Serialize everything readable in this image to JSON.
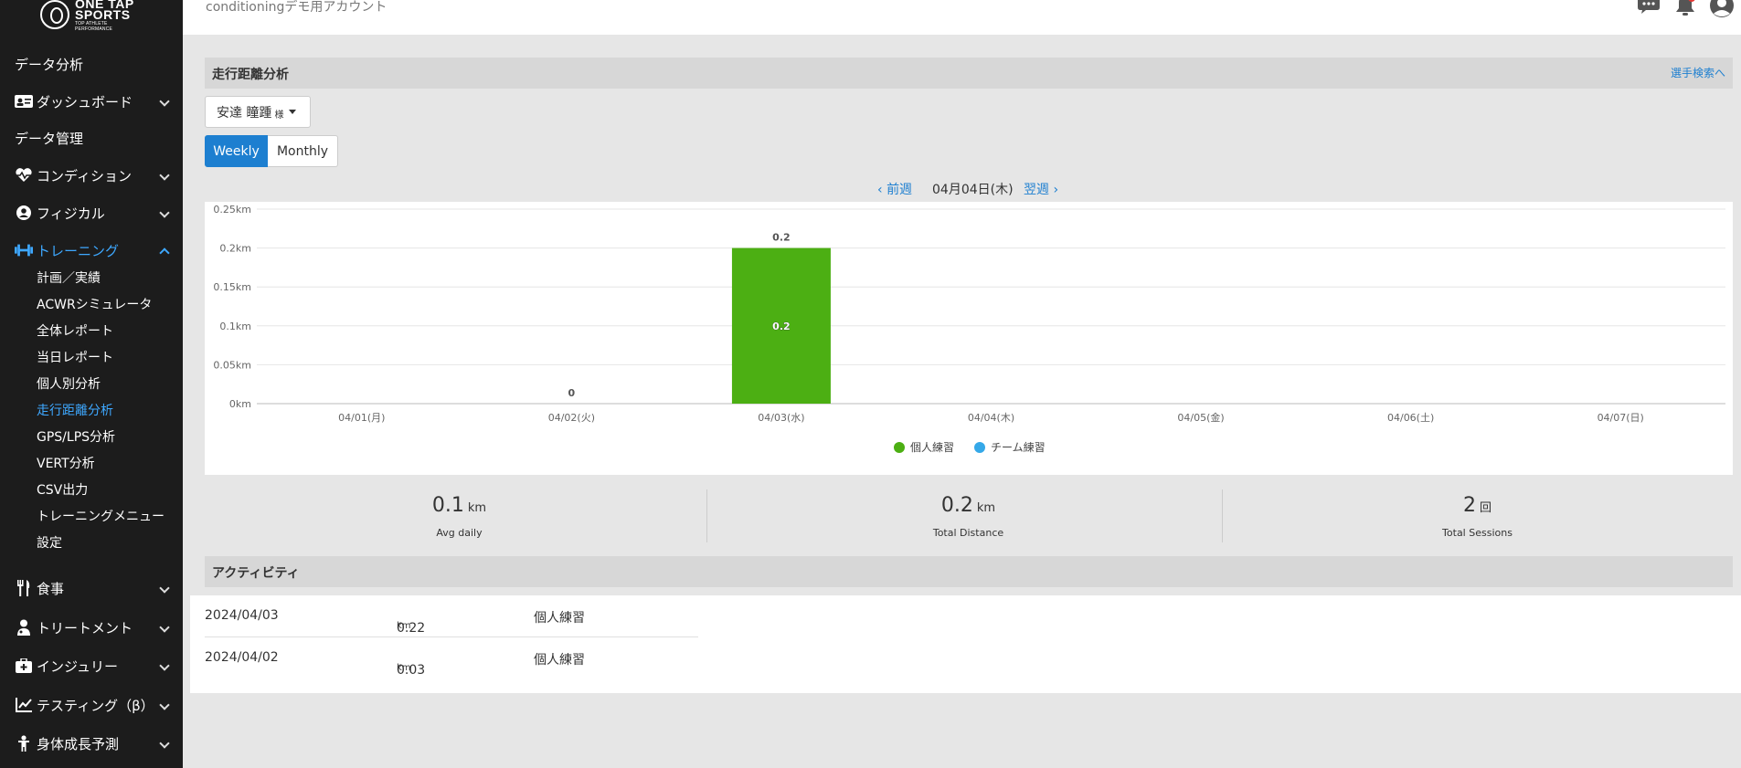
{
  "logo": {
    "line1": "ONE TAP",
    "line2": "SPORTS",
    "tagline": "TOP ATHLETE PERFORMANCE"
  },
  "sidebar": {
    "items": [
      {
        "label": "データ分析",
        "icon": ""
      },
      {
        "label": "ダッシュボード",
        "icon": "id-card-icon"
      },
      {
        "label": "データ管理",
        "icon": ""
      },
      {
        "label": "コンディション",
        "icon": "heart-pulse-icon"
      },
      {
        "label": "フィジカル",
        "icon": "user-circle-icon"
      },
      {
        "label": "トレーニング",
        "icon": "dumbbell-icon"
      },
      {
        "label": "食事",
        "icon": "utensils-icon"
      },
      {
        "label": "トリートメント",
        "icon": "user-doctor-icon"
      },
      {
        "label": "インジュリー",
        "icon": "medkit-icon"
      },
      {
        "label": "テスティング（β）",
        "icon": "chart-line-icon"
      },
      {
        "label": "身体成長予測",
        "icon": "child-icon"
      }
    ],
    "training_sub": [
      "計画／実績",
      "ACWRシミュレータ",
      "全体レポート",
      "当日レポート",
      "個人別分析",
      "走行距離分析",
      "GPS/LPS分析",
      "VERT分析",
      "CSV出力",
      "トレーニングメニュー",
      "設定"
    ]
  },
  "header": {
    "account": "conditioningデモ用アカウント"
  },
  "main": {
    "title": "走行距離分析",
    "search_link": "選手検索へ",
    "player_name": "安達 瞳踵",
    "player_suffix": "様",
    "tabs": [
      "Weekly",
      "Monthly"
    ],
    "prev": "前週",
    "current_date": "04月04日(木)",
    "next": "翌週"
  },
  "chart_data": {
    "type": "bar",
    "categories": [
      "04/01(月)",
      "04/02(火)",
      "04/03(水)",
      "04/04(木)",
      "04/05(金)",
      "04/06(土)",
      "04/07(日)"
    ],
    "series": [
      {
        "name": "個人練習",
        "values": [
          null,
          0,
          0.2,
          null,
          null,
          null,
          null
        ],
        "color": "#4caf13"
      },
      {
        "name": "チーム練習",
        "values": [
          null,
          null,
          null,
          null,
          null,
          null,
          null
        ],
        "color": "#35a8e8"
      }
    ],
    "y_ticks": [
      "0km",
      "0.05km",
      "0.1km",
      "0.15km",
      "0.2km",
      "0.25km"
    ],
    "ylim": [
      0,
      0.25
    ],
    "top_labels": [
      "",
      "0",
      "0.2",
      "",
      "",
      "",
      ""
    ],
    "inner_labels": [
      "",
      "",
      "0.2",
      "",
      "",
      "",
      ""
    ],
    "legend_position": "bottom-center",
    "grid": true
  },
  "stats": [
    {
      "value": "0.1",
      "unit": "km",
      "label": "Avg daily"
    },
    {
      "value": "0.2",
      "unit": "km",
      "label": "Total Distance"
    },
    {
      "value": "2",
      "unit": "回",
      "label": "Total Sessions"
    }
  ],
  "activity": {
    "title": "アクティビティ",
    "rows": [
      {
        "date": "2024/04/03",
        "distance": "0.22",
        "unit": "km",
        "type": "個人練習"
      },
      {
        "date": "2024/04/02",
        "distance": "0.03",
        "unit": "km",
        "type": "個人練習"
      }
    ]
  }
}
